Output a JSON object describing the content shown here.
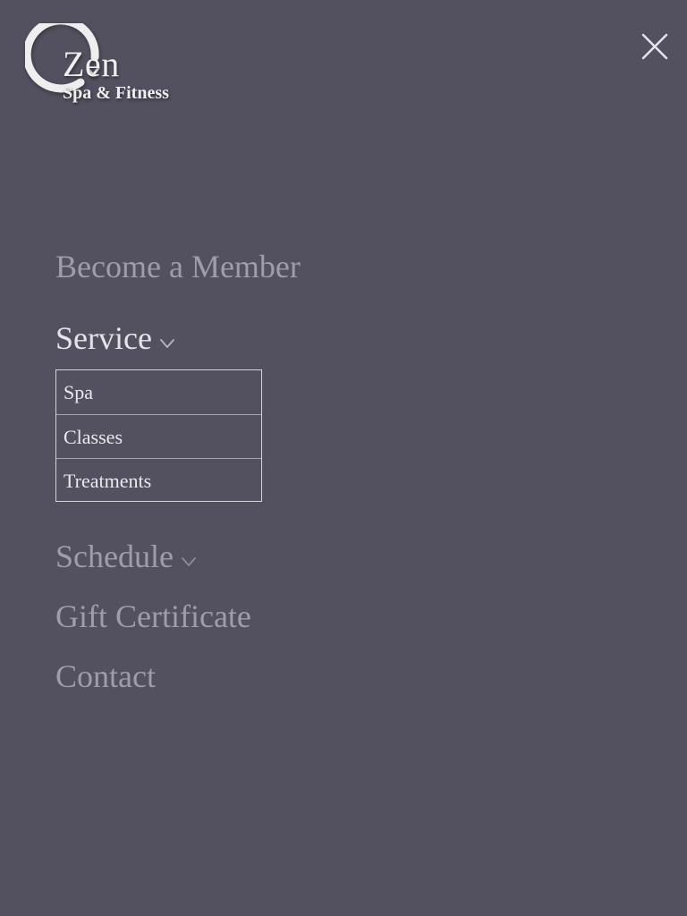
{
  "logo": {
    "brand": "Zen",
    "tagline": "Spa & Fitness"
  },
  "header": {
    "close_icon": "close-icon"
  },
  "nav": {
    "items": [
      {
        "label": "Become a Member",
        "has_submenu": false,
        "active": false
      },
      {
        "label": "Service",
        "has_submenu": true,
        "active": true,
        "expanded": true
      },
      {
        "label": "Schedule",
        "has_submenu": true,
        "active": false,
        "expanded": false
      },
      {
        "label": "Gift Certificate",
        "has_submenu": false,
        "active": false
      },
      {
        "label": "Contact",
        "has_submenu": false,
        "active": false
      }
    ],
    "service_submenu": [
      {
        "label": "Spa"
      },
      {
        "label": "Classes"
      },
      {
        "label": "Treatments"
      }
    ]
  },
  "colors": {
    "background": "#53505f",
    "link_muted": "#a09ca9",
    "link_active": "#e5e3e8",
    "submenu_border": "#d6d4da"
  }
}
